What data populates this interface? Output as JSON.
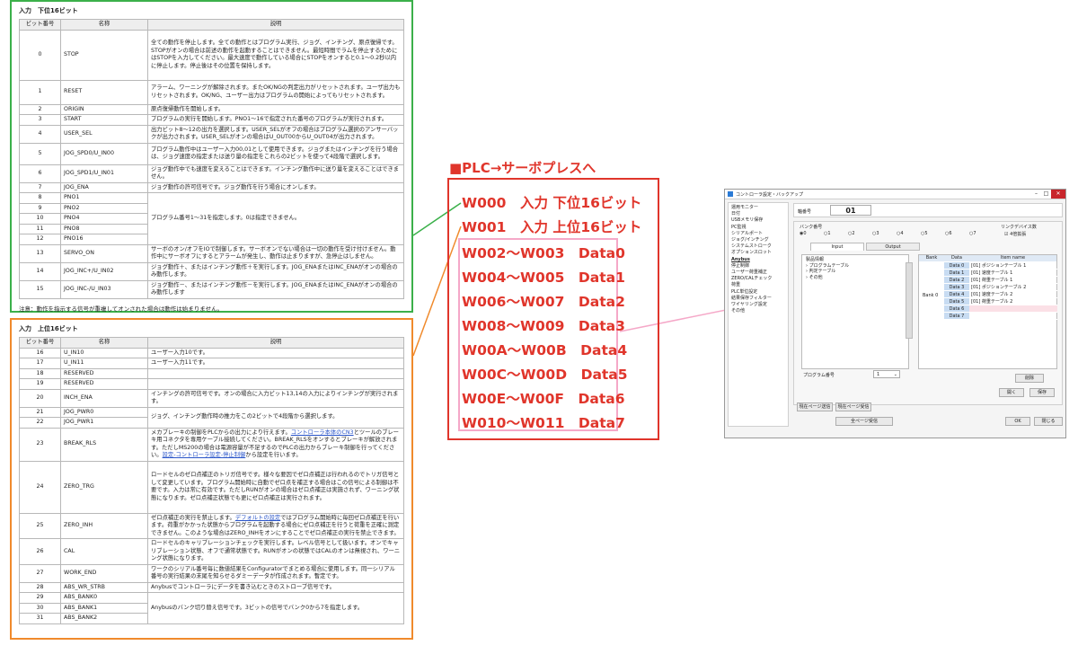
{
  "lower": {
    "title": "入力　下位16ビット",
    "headers": [
      "ビット番号",
      "名称",
      "説明"
    ],
    "rows": [
      {
        "bit": "0",
        "name": "STOP",
        "desc": "全ての動作を停止します。全ての動作とはプログラム実行、ジョグ、インチング、原点復帰です。STOPがオンの場合は前述の動作を起動することはできません。最短時間でラムを停止するためにはSTOPを入力してください。最大速度で動作している場合にSTOPをオンすると0.1～0.2秒以内に停止します。停止後はその位置を保持します。"
      },
      {
        "bit": "1",
        "name": "RESET",
        "desc": "アラーム、ワーニングが解除されます。またOK/NGの判定出力がリセットされます。ユーザ出力もリセットされます。OK/NG、ユーザー出力はプログラムの開始によってもリセットされます。"
      },
      {
        "bit": "2",
        "name": "ORIGIN",
        "desc": "原点復帰動作を開始します。"
      },
      {
        "bit": "3",
        "name": "START",
        "desc": "プログラムの実行を開始します。PNO1～16で指定された番号のプログラムが実行されます。"
      },
      {
        "bit": "4",
        "name": "USER_SEL",
        "desc": "出力ビット8～12の出力を選択します。USER_SELがオフの場合はプログラム選択のアンサーバックが出力されます。USER_SELがオンの場合はU_OUT00からU_OUT04が出力されます。"
      },
      {
        "bit": "5",
        "name": "JOG_SPD0/U_IN00",
        "desc": "プログラム動作中はユーザー入力00,01として使用できます。ジョグまたはインチングを行う場合は、ジョグ速度の指定または送り量の指定をこれらの2ビットを使って4段階で選択します。"
      },
      {
        "bit": "6",
        "name": "JOG_SPD1/U_IN01",
        "desc": "ジョグ動作中でも速度を変えることはできます。インチング動作中に送り量を変えることはできません。"
      },
      {
        "bit": "7",
        "name": "JOG_ENA",
        "desc": "ジョグ動作の許可信号です。ジョグ動作を行う場合にオンします。"
      },
      {
        "bit": "8",
        "name": "PNO1",
        "desc": ""
      },
      {
        "bit": "9",
        "name": "PNO2",
        "desc": ""
      },
      {
        "bit": "10",
        "name": "PNO4",
        "desc": ""
      },
      {
        "bit": "11",
        "name": "PNO8",
        "desc": ""
      },
      {
        "bit": "12",
        "name": "PNO16",
        "desc": ""
      },
      {
        "bit": "13",
        "name": "SERVO_ON",
        "desc": "サーボのオン/オフをIOで制御します。サーボオンでない場合は一切の動作を受け付けません。動作中にサーボオフにするとアラームが発生し、動作は止まりますが、急停止はしません。"
      },
      {
        "bit": "14",
        "name": "JOG_INC+/U_IN02",
        "desc": "ジョグ動作＋、またはインチング動作＋を実行します。JOG_ENAまたはINC_ENAがオンの場合のみ動作します。"
      },
      {
        "bit": "15",
        "name": "JOG_INC-/U_IN03",
        "desc": "ジョグ動作－、またはインチング動作－を実行します。JOG_ENAまたはINC_ENAがオンの場合のみ動作します"
      }
    ],
    "pno_desc": "プログラム番号1～31を指定します。0は指定できません。",
    "note": "注意：動作を指示する信号が重複してオンされた場合は動作は始まりません。"
  },
  "upper": {
    "title": "入力　上位16ビット",
    "headers": [
      "ビット番号",
      "名称",
      "説明"
    ],
    "rows": [
      {
        "bit": "16",
        "name": "U_IN10",
        "desc": "ユーザー入力10です。"
      },
      {
        "bit": "17",
        "name": "U_IN11",
        "desc": "ユーザー入力11です。"
      },
      {
        "bit": "18",
        "name": "RESERVED",
        "desc": ""
      },
      {
        "bit": "19",
        "name": "RESERVED",
        "desc": ""
      },
      {
        "bit": "20",
        "name": "INCH_ENA",
        "desc": "インチングの許可信号です。オンの場合に入力ビット13,14の入力によりインチングが実行されます。"
      },
      {
        "bit": "21",
        "name": "JOG_PWR0",
        "desc": ""
      },
      {
        "bit": "22",
        "name": "JOG_PWR1",
        "desc": ""
      },
      {
        "bit": "23",
        "name": "BREAK_RLS",
        "desc": ""
      },
      {
        "bit": "24",
        "name": "ZERO_TRG",
        "desc": "ロードセルのゼロ点補正のトリガ信号です。様々な要因でゼロ点補正は行われるのでトリガ信号として変更しています。プログラム開始時に自動でゼロ点を補正する場合はこの信号による制御は不要です。入力は常に有効です。ただしRUNがオンの場合はゼロ点補正は実施されず、ワーニング状態になります。ゼロ点補正状態でも更にゼロ点補正は実行されます。"
      },
      {
        "bit": "25",
        "name": "ZERO_INH",
        "desc": ""
      },
      {
        "bit": "26",
        "name": "CAL",
        "desc": "ロードセルのキャリブレーションチェックを実行します。レベル信号として扱います。オンでキャリブレーション状態、オフで通常状態です。RUNがオンの状態ではCALのオンは無視され、ワーニング状態になります。"
      },
      {
        "bit": "27",
        "name": "WORK_END",
        "desc": "ワークのシリアル番号毎に数値結果をConfiguratorでまとめる場合に使用します。同一シリアル番号の実行結果の末尾を知らせるダミーデータが作成されます。暫定です。"
      },
      {
        "bit": "28",
        "name": "ABS_WR_STRB",
        "desc": "Anybusでコントローラにデータを書き込むときのストローブ信号です。"
      },
      {
        "bit": "29",
        "name": "ABS_BANK0",
        "desc": ""
      },
      {
        "bit": "30",
        "name": "ABS_BANK1",
        "desc": ""
      },
      {
        "bit": "31",
        "name": "ABS_BANK2",
        "desc": ""
      }
    ],
    "jog_pwr_desc": "ジョグ、インチング動作時の推力をこの2ビットで4段階から選択します。",
    "break_pre": "メカブレーキの制御をPLCからの出力により行えます。",
    "break_link1": "コントローラ本体のCN3",
    "break_mid": "とツールのブレーキ用コネクタを専用ケーブル接続してください。BREAK_RLSをオンするとブレーキが解放されます。ただしMS200の場合は電源容量が不足するのでPLCの出力からブレーキ制御を行ってください。",
    "break_link2": "設定-コントローラ設定-停止制御",
    "break_post": "から設定を行います。",
    "zero_inh_pre": "ゼロ点補正の実行を禁止します。",
    "zero_inh_link": "デフォルトの設定",
    "zero_inh_post": "ではプログラム開始時に毎回ゼロ点補正を行います。荷重がかかった状態からプログラムを起動する場合にゼロ点補正を行うと荷重を正確に測定できません。このような場合はZERO_INHをオンにすることでゼロ点補正の実行を禁止できます。",
    "bank_desc": "Anybusのバンク切り替え信号です。3ビットの信号でバンク0から7を指定します。"
  },
  "plc": {
    "title": "■PLC→サーボプレスへ",
    "rows": [
      "W000　入力 下位16ビット",
      "W001　入力 上位16ビット",
      "W002～W003　Data0",
      "W004～W005　Data1",
      "W006～W007　Data2",
      "W008～W009　Data3",
      "W00A～W00B　Data4",
      "W00C～W00D　Data5",
      "W00E～W00F　Data6",
      "W010～W011　Data7"
    ]
  },
  "window": {
    "title": "コントローラ設定・バックアップ",
    "tree": [
      "運用モニター",
      "日付",
      "USBメモリ保存",
      "PC監視",
      "シリアルポート",
      "ジョグ/インチング",
      "システムストローク",
      "オプションスロット",
      "Anybus",
      "停止制御",
      "ユーザー荷重補正",
      "ZERO/CALチェック",
      "荷重",
      "PLC単位設定",
      "結果保存フィルター",
      "ワイヤリング設定",
      "その他"
    ],
    "selected_tree": "Anybus",
    "id_label": "軸番号",
    "id_value": "01",
    "bank_group_label": "バンク番号",
    "bank_options": [
      "0",
      "1",
      "2",
      "3",
      "4",
      "5",
      "6",
      "7"
    ],
    "link_label": "リンクデバイス数",
    "link_check": "4倍拡張",
    "tab_input": "Input",
    "tab_output": "Output",
    "inner_tree": [
      "製品情報",
      "プログラムテーブル",
      "判定テーブル",
      "その他"
    ],
    "grid_headers": [
      "Bank",
      "Data",
      "Item name"
    ],
    "bank_name": "Bank 0",
    "grid_rows": [
      {
        "data": "Data 0",
        "item": "[01] ポジションテーブル 1"
      },
      {
        "data": "Data 1",
        "item": "[01] 速度テーブル 1"
      },
      {
        "data": "Data 2",
        "item": "[01] 荷重テーブル 1"
      },
      {
        "data": "Data 3",
        "item": "[01] ポジションテーブル 2"
      },
      {
        "data": "Data 4",
        "item": "[01] 速度テーブル 2"
      },
      {
        "data": "Data 5",
        "item": "[01] 荷重テーブル 2"
      },
      {
        "data": "Data 6",
        "item": ""
      },
      {
        "data": "Data 7",
        "item": ""
      }
    ],
    "program_label": "プログラム番号",
    "program_value": "1",
    "delete_btn": "削除",
    "open_btn": "開く",
    "save_btn": "保存",
    "page_send": "現在ページ送信",
    "page_recv": "現在ページ受信",
    "all_recv": "全ページ受信",
    "ok_btn": "OK",
    "close_btn": "閉じる"
  },
  "colors": {
    "lower_border": "#3bb04a",
    "upper_border": "#f08a2c",
    "plc_red": "#e0352b",
    "data_pink": "#f5a8c8"
  }
}
